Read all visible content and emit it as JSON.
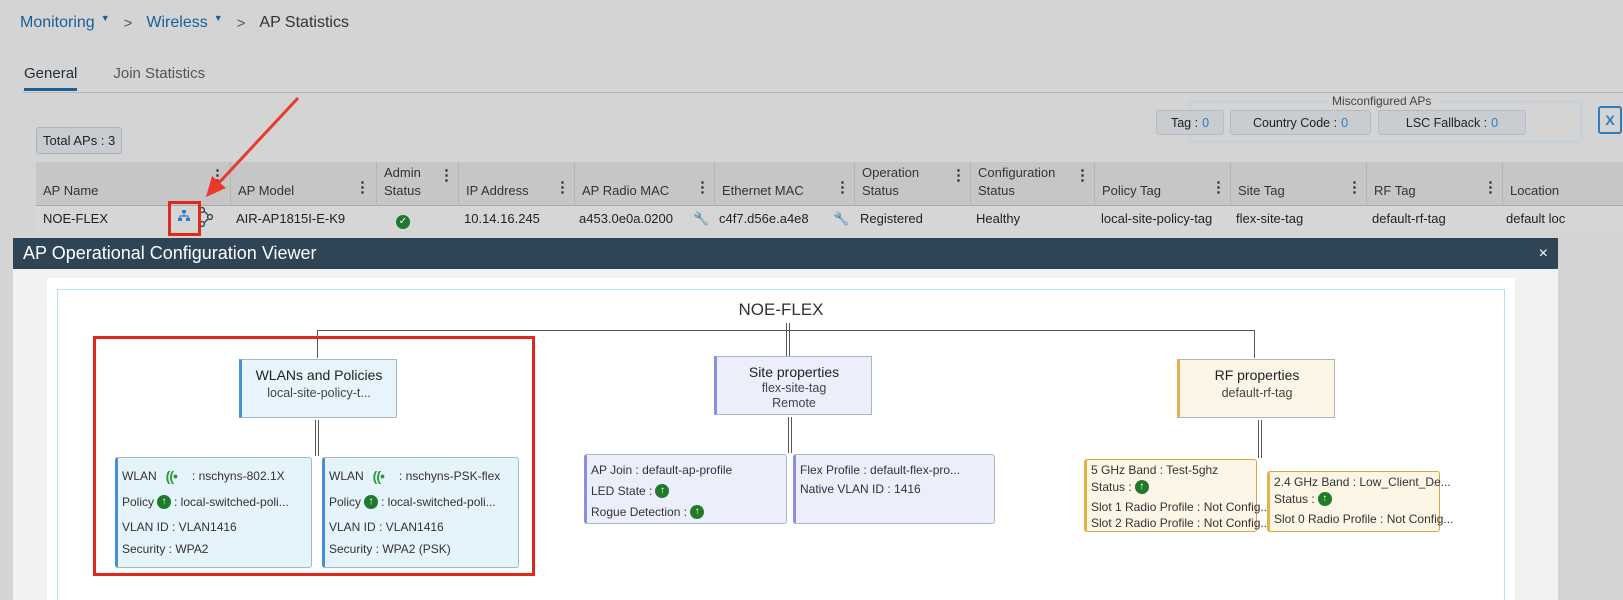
{
  "breadcrumb": {
    "monitoring": "Monitoring",
    "wireless": "Wireless",
    "separator": ">",
    "current": "AP Statistics"
  },
  "tabs": [
    {
      "label": "General",
      "active": true
    },
    {
      "label": "Join Statistics",
      "active": false
    }
  ],
  "total_aps": "Total APs : 3",
  "misconfigured": {
    "title": "Misconfigured APs",
    "tag_label": "Tag :",
    "tag_value": "0",
    "country_label": "Country Code :",
    "country_value": "0",
    "lsc_label": "LSC Fallback :",
    "lsc_value": "0"
  },
  "export_icon": "excel-export-icon",
  "table": {
    "headers": {
      "ap_name": "AP Name",
      "ap_model": "AP Model",
      "admin_status": [
        "Admin",
        "Status"
      ],
      "ip_address": "IP Address",
      "radio_mac": "AP Radio MAC",
      "ethernet_mac": "Ethernet MAC",
      "operation_status": [
        "Operation",
        "Status"
      ],
      "configuration_status": [
        "Configuration",
        "Status"
      ],
      "policy_tag": "Policy Tag",
      "site_tag": "Site Tag",
      "rf_tag": "RF Tag",
      "location": "Location"
    },
    "row": {
      "ap_name": "NOE-FLEX",
      "ap_model": "AIR-AP1815I-E-K9",
      "ip_address": "10.14.16.245",
      "radio_mac": "a453.0e0a.0200",
      "ethernet_mac": "c4f7.d56e.a4e8",
      "operation_status": "Registered",
      "configuration_status": "Healthy",
      "policy_tag": "local-site-policy-tag",
      "site_tag": "flex-site-tag",
      "rf_tag": "default-rf-tag",
      "location": "default loc"
    }
  },
  "modal": {
    "title": "AP Operational Configuration Viewer",
    "close": "×",
    "root": "NOE-FLEX",
    "wlans_node": {
      "title": "WLANs and Policies",
      "subtitle": "local-site-policy-t..."
    },
    "site_node": {
      "title": "Site properties",
      "subtitle": "flex-site-tag",
      "mode": "Remote"
    },
    "rf_node": {
      "title": "RF properties",
      "subtitle": "default-rf-tag"
    },
    "wlan_cards": [
      {
        "wlan_label": "WLAN",
        "wlan_value": ": nschyns-802.1X",
        "policy_label": "Policy",
        "policy_value": ": local-switched-poli...",
        "vlan": "VLAN ID : VLAN1416",
        "security": "Security : WPA2"
      },
      {
        "wlan_label": "WLAN",
        "wlan_value": ": nschyns-PSK-flex",
        "policy_label": "Policy",
        "policy_value": ": local-switched-poli...",
        "vlan": "VLAN ID : VLAN1416",
        "security": "Security : WPA2 (PSK)"
      }
    ],
    "site_card1": {
      "ap_join": "AP Join : default-ap-profile",
      "led": "LED State :",
      "rogue": "Rogue Detection :"
    },
    "site_card2": {
      "flex": "Flex Profile : default-flex-pro...",
      "native_vlan": "Native VLAN ID : 1416"
    },
    "rf_card1": {
      "band": "5 GHz Band : Test-5ghz",
      "status": "Status :",
      "slot1": "Slot 1 Radio Profile : Not Config...",
      "slot2": "Slot 2 Radio Profile : Not Config..."
    },
    "rf_card2": {
      "band": "2.4 GHz Band  : Low_Client_De...",
      "status": "Status :",
      "slot0": "Slot 0 Radio Profile : Not Config..."
    }
  },
  "annotation_color": "#e0281c"
}
